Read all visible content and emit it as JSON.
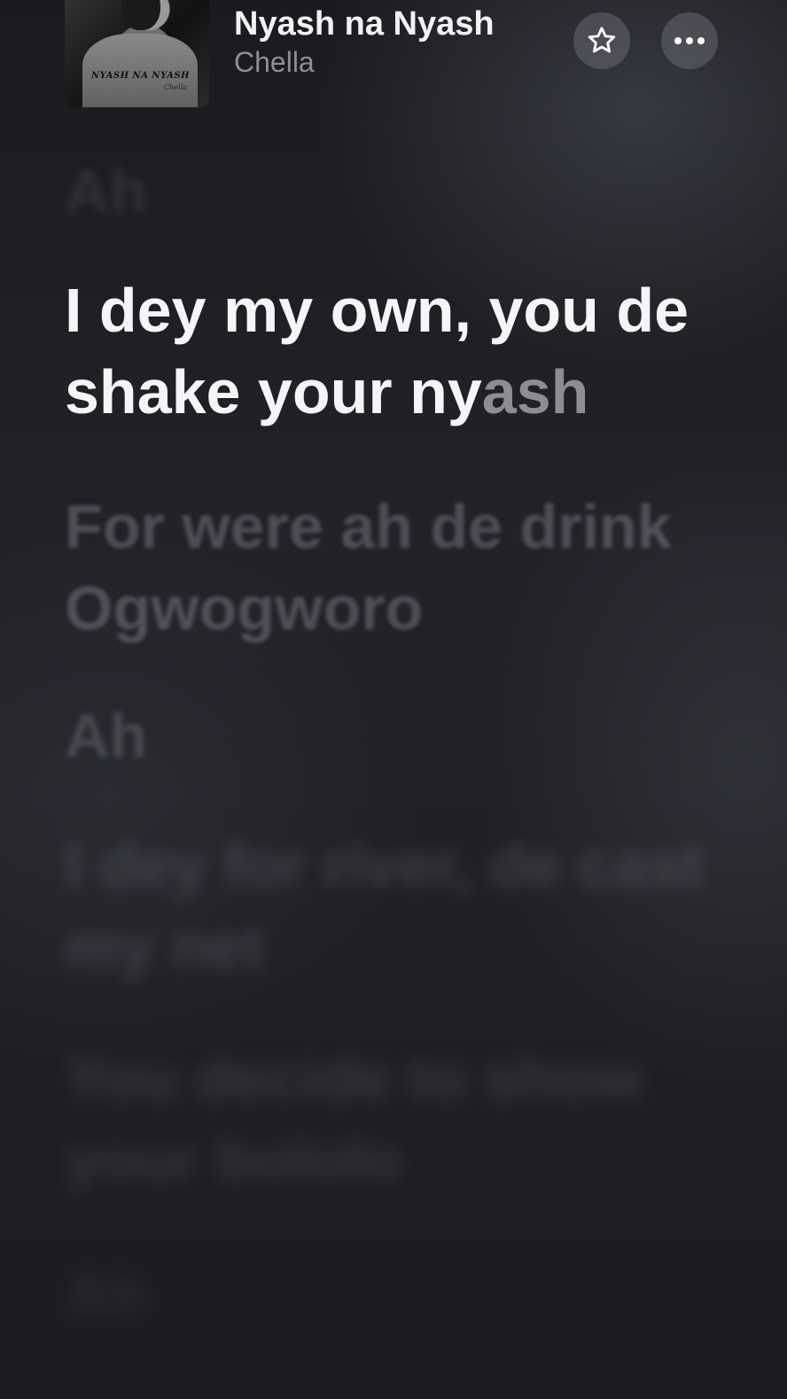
{
  "now_playing": {
    "title": "Nyash na Nyash",
    "artist": "Chella",
    "artwork_text": {
      "title": "NYASH NA NYASH",
      "artist": "Chella"
    }
  },
  "actions": {
    "favorite_icon": "star-icon",
    "more_icon": "ellipsis-icon"
  },
  "lyrics": {
    "previous": "Ah",
    "current_sung": "I dey my own, you de shake your ny",
    "current_unsung": "ash",
    "upcoming": [
      "For were ah de drink Ogwogworo",
      "Ah",
      "I dey for river, de cast my net",
      "You decide to show your bololo",
      "Ah"
    ]
  },
  "colors": {
    "active_lyric": "#f5f5f7",
    "inactive_lyric": "#8d8d92",
    "artist": "#8e8e93",
    "background": "#1d1d22"
  }
}
